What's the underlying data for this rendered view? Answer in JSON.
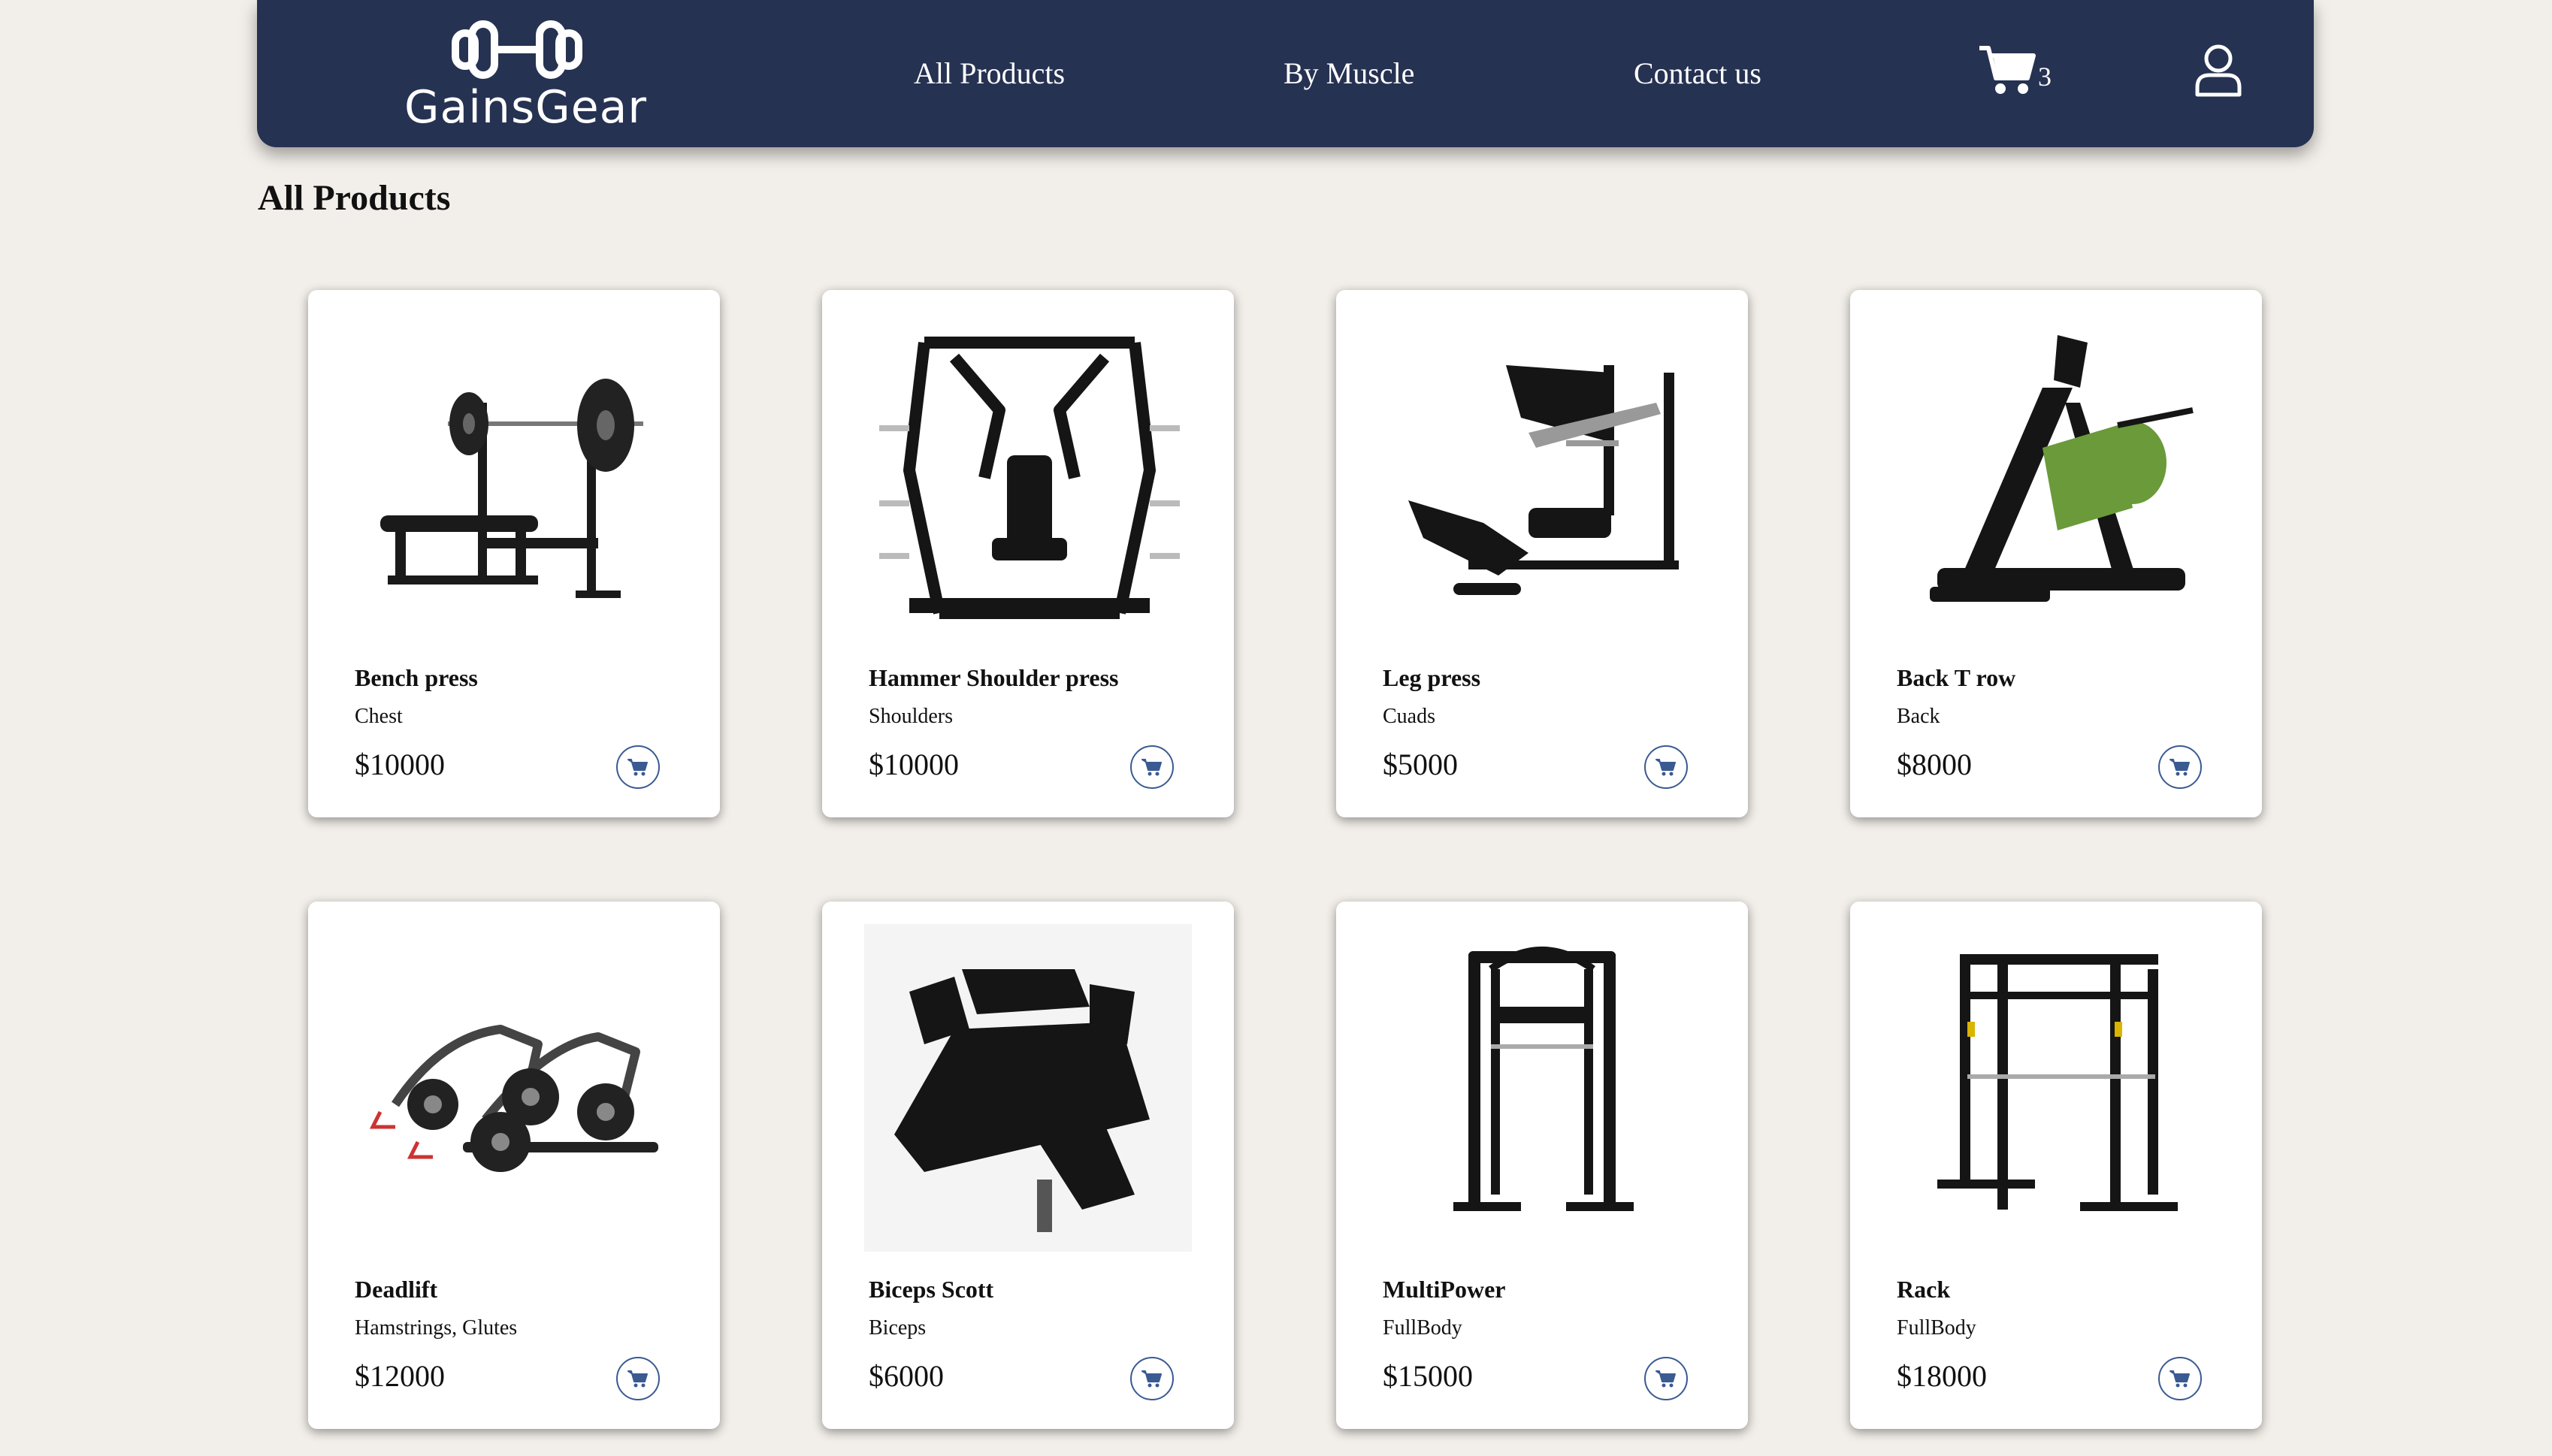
{
  "header": {
    "brand": "GainsGear",
    "nav": [
      "All Products",
      "By Muscle",
      "Contact us"
    ],
    "cart_count": "3",
    "icons": {
      "logo": "dumbbell-icon",
      "cart": "cart-icon",
      "user": "user-icon"
    }
  },
  "main": {
    "title": "All Products",
    "products": [
      {
        "name": "Bench press",
        "category": "Chest",
        "price": "$10000"
      },
      {
        "name": "Hammer Shoulder press",
        "category": "Shoulders",
        "price": "$10000"
      },
      {
        "name": "Leg press",
        "category": "Cuads",
        "price": "$5000"
      },
      {
        "name": "Back T row",
        "category": "Back",
        "price": "$8000"
      },
      {
        "name": "Deadlift",
        "category": "Hamstrings, Glutes",
        "price": "$12000"
      },
      {
        "name": "Biceps Scott",
        "category": "Biceps",
        "price": "$6000"
      },
      {
        "name": "MultiPower",
        "category": "FullBody",
        "price": "$15000"
      },
      {
        "name": "Rack",
        "category": "FullBody",
        "price": "$18000"
      }
    ]
  },
  "colors": {
    "navbar": "#263252",
    "background": "#f2eee9",
    "accent": "#3a5a92",
    "machine_green": "#6a9a3a"
  }
}
